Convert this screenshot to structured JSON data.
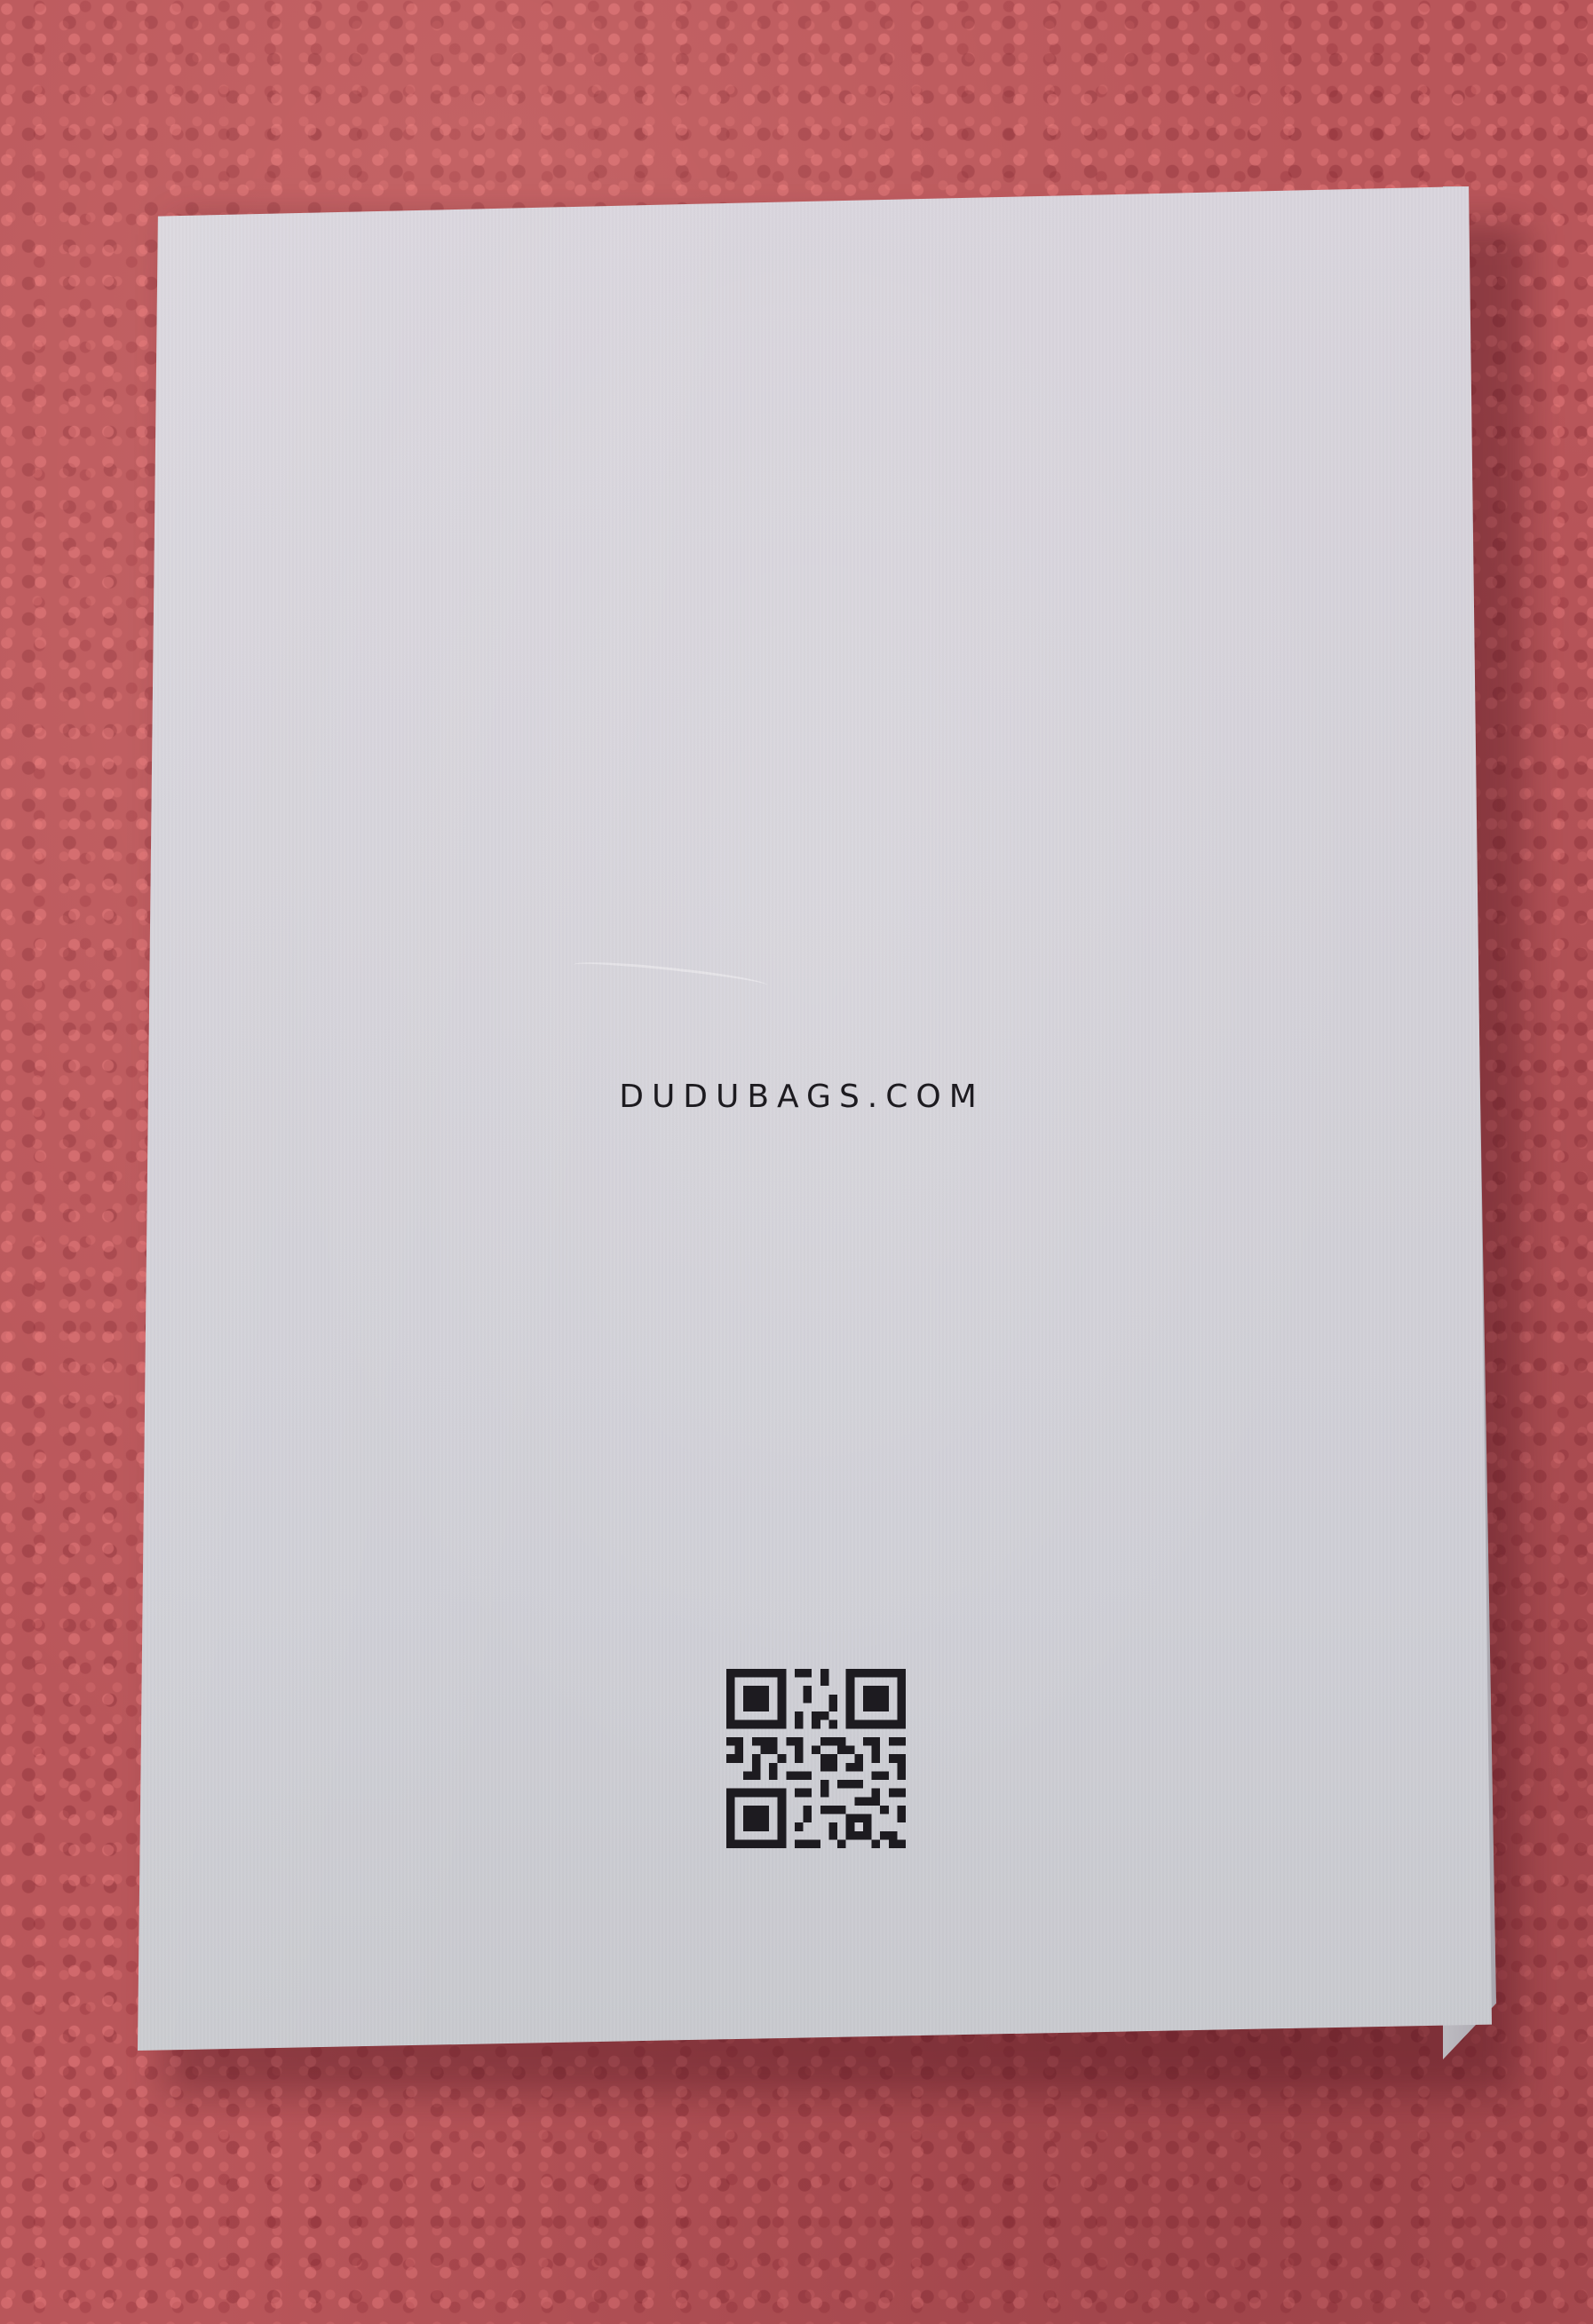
{
  "scene": {
    "background_color": "#b9565a",
    "box_color": "#d5d2d9",
    "ink_color": "#1d1b20"
  },
  "box": {
    "website_text": "DUDUBAGS.COM",
    "qr_code_icon": "qr-code-icon"
  }
}
